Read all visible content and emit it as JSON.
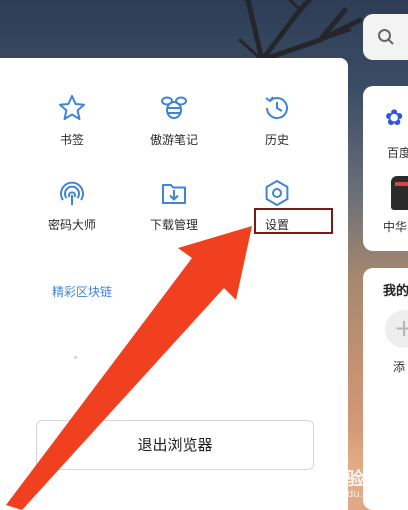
{
  "menu": {
    "items": [
      {
        "label": "书签",
        "icon": "star-icon"
      },
      {
        "label": "傲游笔记",
        "icon": "bee-icon"
      },
      {
        "label": "历史",
        "icon": "history-clock-icon"
      },
      {
        "label": "密码大师",
        "icon": "fingerprint-icon"
      },
      {
        "label": "下载管理",
        "icon": "download-folder-icon"
      },
      {
        "label": "设置",
        "icon": "gear-icon"
      }
    ],
    "section_link": "精彩区块链",
    "exit_label": "退出浏览器"
  },
  "background_app": {
    "card1_label_top": "百度",
    "card1_label_bottom": "中华",
    "card2_title": "我的",
    "card2_add_label": "添"
  },
  "watermark": {
    "logo": "Bai 经验",
    "url": "jingyan.baidu.com"
  },
  "colors": {
    "icon_blue": "#3f84d9",
    "highlight_box": "#7a1a14",
    "arrow_red": "#f0401f"
  }
}
